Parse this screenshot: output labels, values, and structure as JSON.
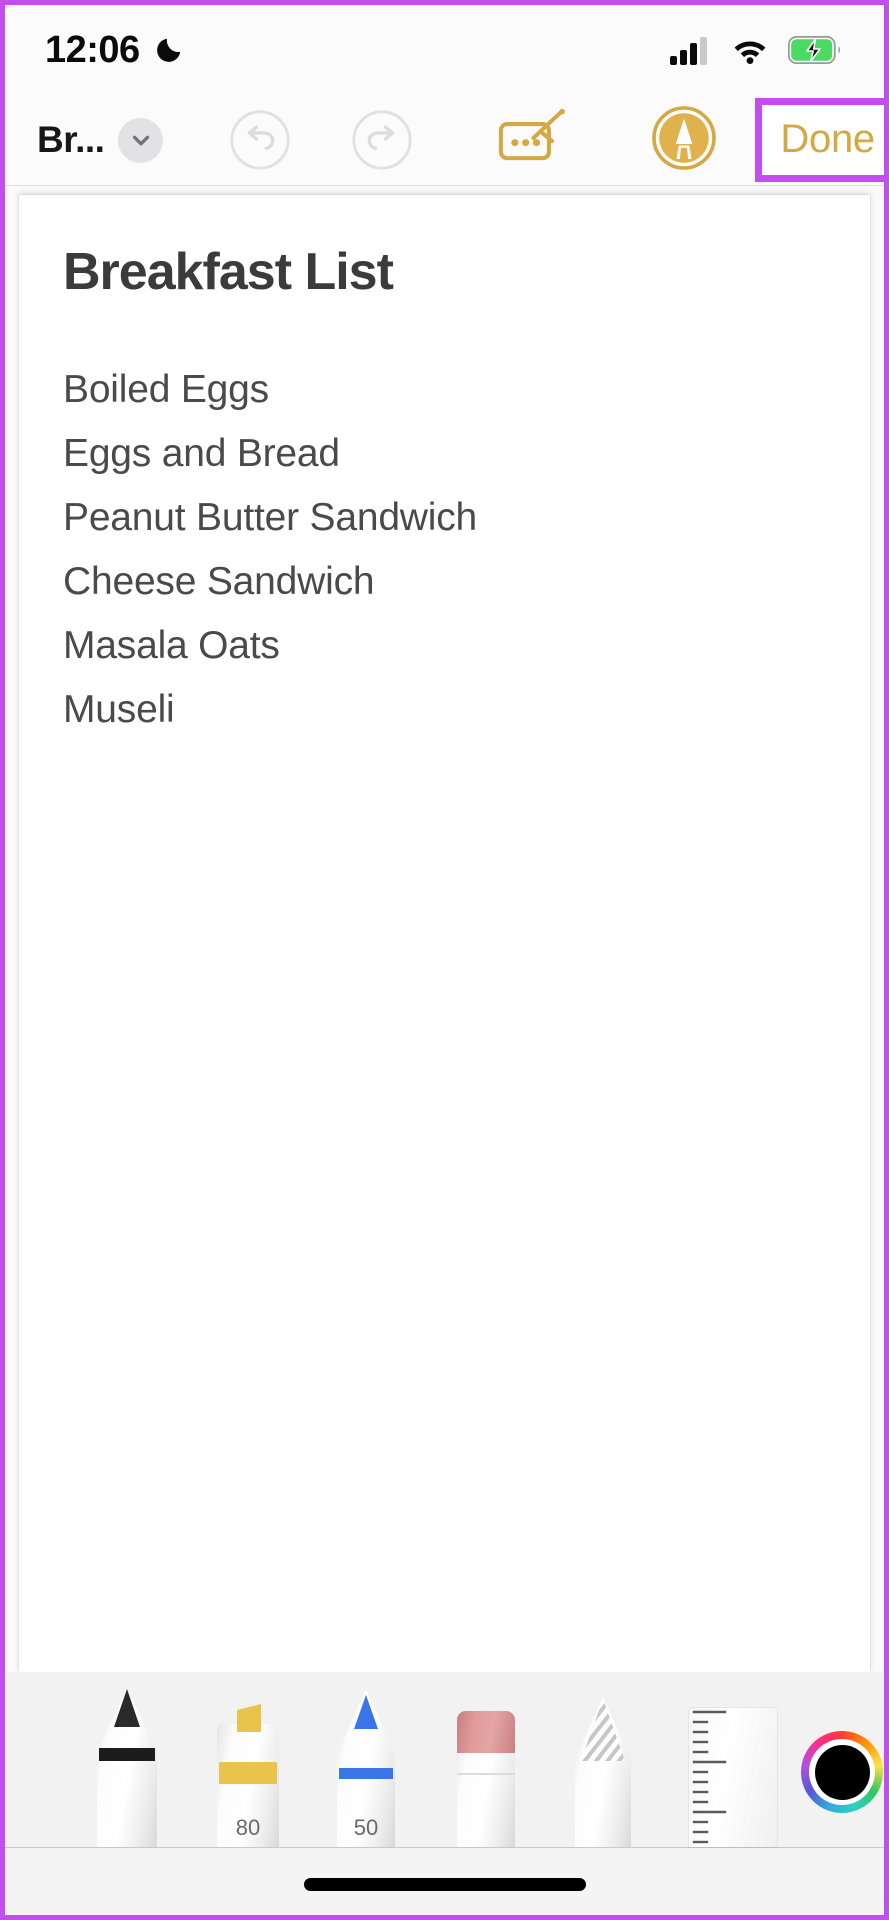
{
  "status_bar": {
    "time": "12:06",
    "dnd_icon": "moon-icon",
    "cellular_icon": "signal-bars-icon",
    "wifi_icon": "wifi-icon",
    "battery_icon": "battery-charging-icon",
    "battery_color": "#4cd964",
    "signal_bars_filled": 3,
    "signal_bars_total": 4
  },
  "nav_toolbar": {
    "note_title": "Br...",
    "chevron_icon": "chevron-down-icon",
    "undo_icon": "undo-icon",
    "redo_icon": "redo-icon",
    "undo_enabled": false,
    "redo_enabled": false,
    "markup_icon": "scribble-to-text-icon",
    "pen_icon": "pen-nib-circle-icon",
    "done_label": "Done",
    "accent_color": "#d4a843",
    "highlight_color": "#c44df0"
  },
  "note": {
    "heading": "Breakfast List",
    "lines": [
      "Boiled Eggs",
      "Eggs and Bread",
      "Peanut Butter Sandwich",
      "Cheese Sandwich",
      "Masala Oats",
      "Museli"
    ]
  },
  "tool_palette": {
    "tools": [
      {
        "name": "pen-tool",
        "label": "Pen",
        "color": "#1c1c1c",
        "size": ""
      },
      {
        "name": "highlighter-tool",
        "label": "Highlighter",
        "color": "#e9c44a",
        "size": "80"
      },
      {
        "name": "pencil-tool",
        "label": "Pencil",
        "color": "#3b76e8",
        "size": "50"
      },
      {
        "name": "eraser-tool",
        "label": "Eraser",
        "color": "#d98b8b",
        "size": ""
      },
      {
        "name": "lasso-tool",
        "label": "Lasso",
        "color": "#c8c8c8",
        "size": ""
      },
      {
        "name": "ruler-tool",
        "label": "Ruler",
        "color": "#5a5a5a",
        "size": ""
      }
    ],
    "color_picker": {
      "name": "color-picker",
      "selected_color": "#000000",
      "ring": "rainbow"
    },
    "add_button": {
      "name": "add-color-button",
      "glyph": "+"
    }
  },
  "home_indicator": {
    "name": "home-indicator"
  }
}
